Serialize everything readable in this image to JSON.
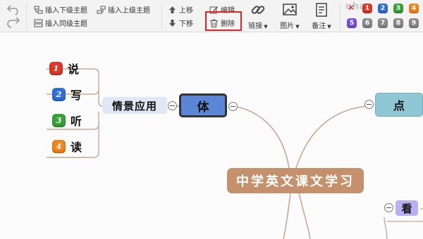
{
  "toolbar": {
    "insert_sub": "插入下级主题",
    "insert_parent": "插入上级主题",
    "insert_sibling": "插入同级主题",
    "move_up": "上移",
    "move_down": "下移",
    "edit": "编辑",
    "delete": "删除",
    "link": "链接",
    "image": "图片",
    "note": "备注",
    "watermark": "uhaa",
    "priority_row1": [
      {
        "label": "1",
        "color": "#d93a2b"
      },
      {
        "label": "2",
        "color": "#2f6fd6"
      },
      {
        "label": "3",
        "color": "#3aa23a"
      },
      {
        "label": "4",
        "color": "#f0861f"
      }
    ],
    "priority_row2": [
      {
        "label": "5",
        "color": "#7a4fd6"
      },
      {
        "label": "6",
        "color": "#8a8a8a"
      },
      {
        "label": "7",
        "color": "#8a8a8a"
      },
      {
        "label": "8",
        "color": "#8a8a8a"
      },
      {
        "label": "9",
        "color": "#8a8a8a"
      }
    ]
  },
  "mindmap": {
    "central": "中学英文课文学习",
    "branch_left": "体",
    "subtopic_left": "情景应用",
    "leaves": [
      {
        "num": "1",
        "text": "说",
        "color": "#d93a2b"
      },
      {
        "num": "2",
        "text": "写",
        "color": "#2f6fd6"
      },
      {
        "num": "3",
        "text": "听",
        "color": "#3aa23a"
      },
      {
        "num": "4",
        "text": "读",
        "color": "#f0861f"
      }
    ],
    "branch_right_top": "点",
    "branch_right_bottom": "看"
  }
}
